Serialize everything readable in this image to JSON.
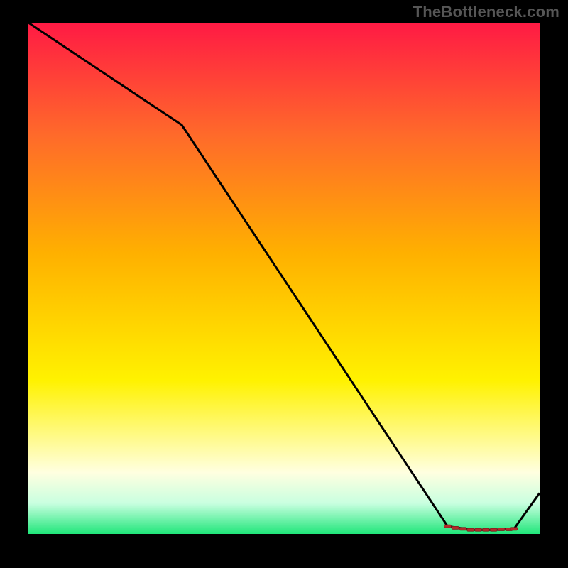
{
  "attribution": "TheBottleneck.com",
  "colors": {
    "black": "#000000",
    "curve": "#000000",
    "marker_fill": "#b22a2a",
    "marker_stroke": "#7a1d1d",
    "grad_top": "#ff1a44",
    "grad_mid1": "#ff6a2a",
    "grad_mid2": "#ffb000",
    "grad_mid3": "#fff200",
    "grad_pale": "#ffffe0",
    "grad_mint": "#c9ffe0",
    "grad_green": "#20e67a"
  },
  "chart_data": {
    "type": "line",
    "title": "",
    "xlabel": "",
    "ylabel": "",
    "xlim": [
      0,
      100
    ],
    "ylim": [
      0,
      100
    ],
    "x": [
      0,
      30,
      82,
      87,
      91,
      95,
      100
    ],
    "values": [
      100,
      80,
      1.5,
      0.8,
      0.8,
      1.0,
      8
    ],
    "flat_region_x": [
      82,
      95
    ],
    "markers": {
      "x": [
        82,
        83.5,
        85,
        86.5,
        88,
        89.5,
        91,
        92.5,
        94,
        95
      ],
      "y": [
        1.5,
        1.2,
        1.0,
        0.8,
        0.8,
        0.8,
        0.8,
        0.9,
        0.9,
        1.0
      ]
    }
  }
}
